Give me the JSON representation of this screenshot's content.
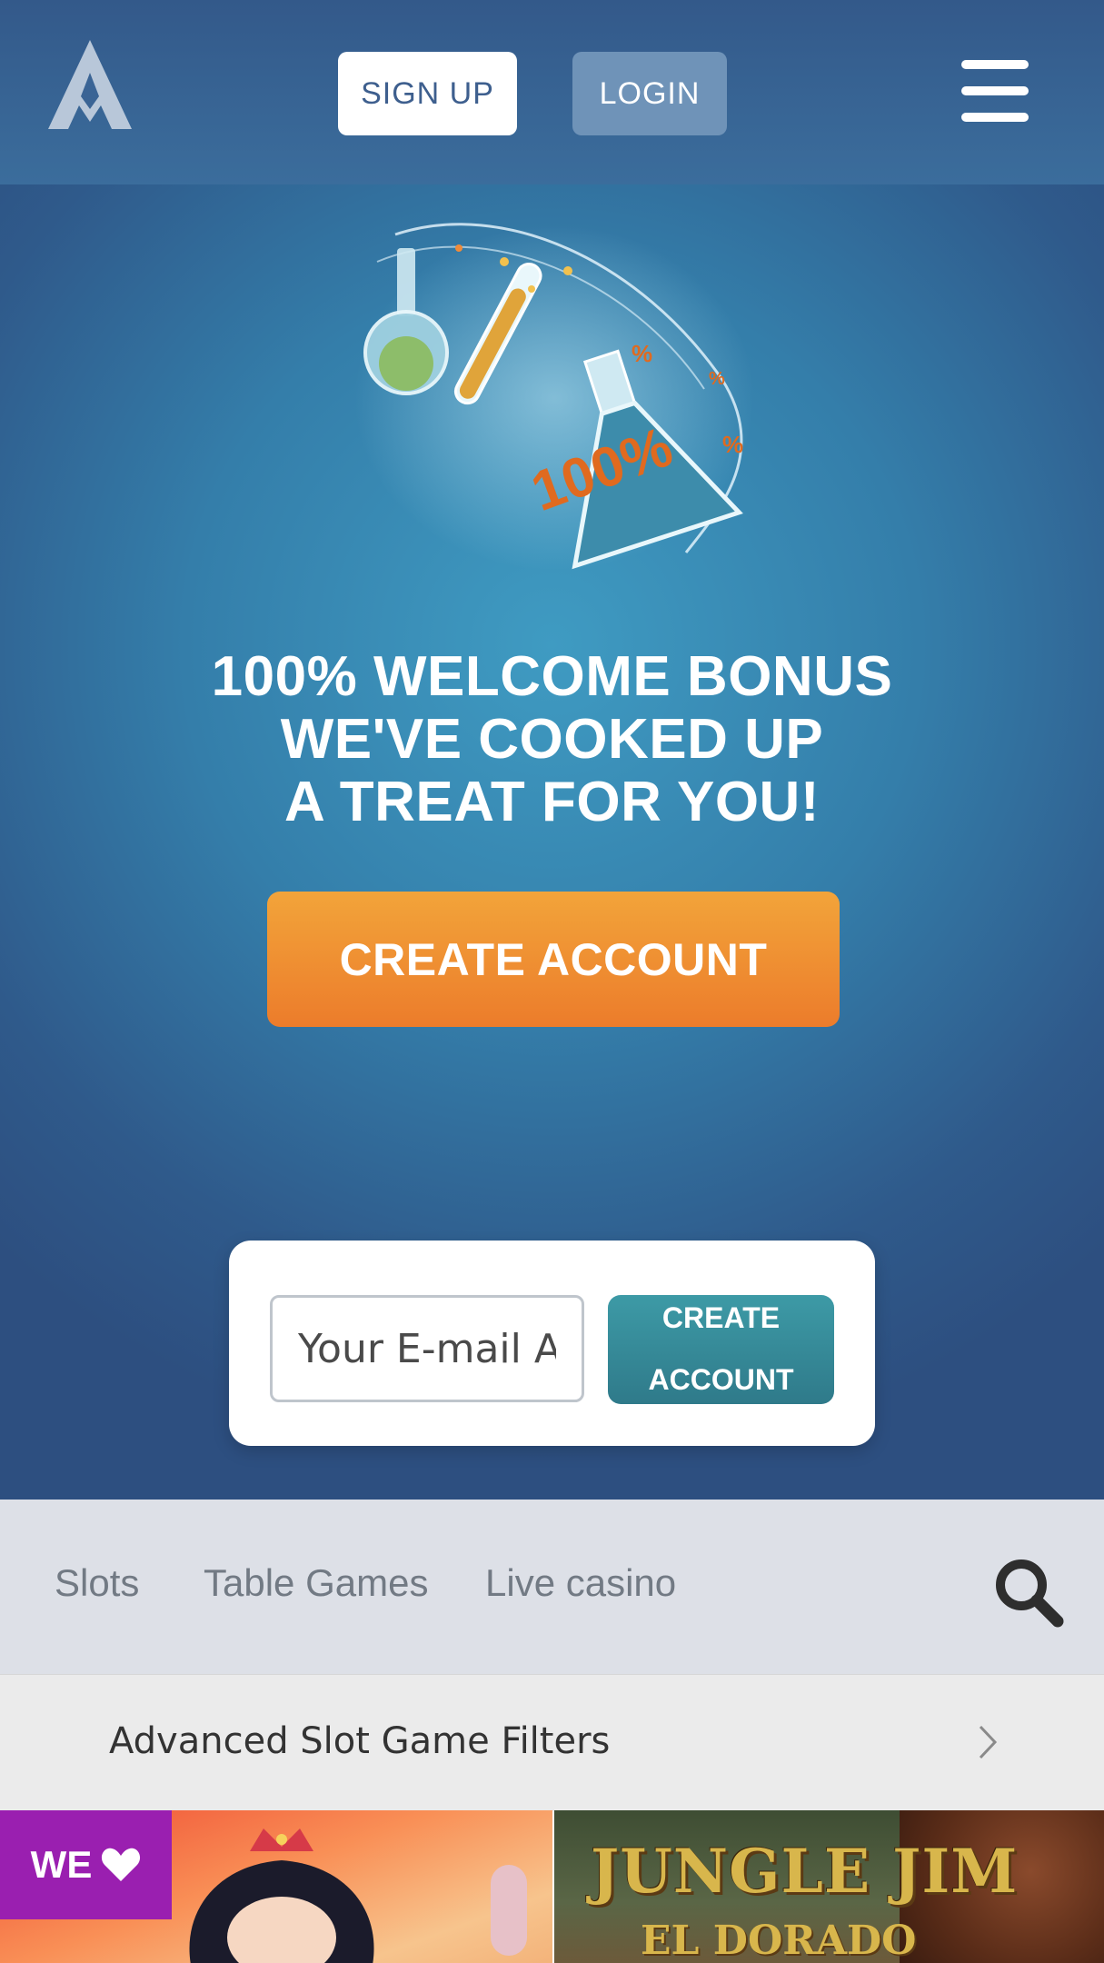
{
  "header": {
    "logo_icon": "alpha-a-logo-icon",
    "signup_label": "SIGN UP",
    "login_label": "LOGIN",
    "menu_icon": "hamburger-menu-icon"
  },
  "hero": {
    "art_icon": "potion-flasks-icon",
    "art_text": "100%",
    "headline": [
      "100% WELCOME BONUS",
      "WE'VE COOKED UP",
      "A TREAT FOR YOU!"
    ],
    "cta_label": "CREATE ACCOUNT"
  },
  "signup_card": {
    "email_placeholder": "Your E-mail A",
    "button_line1": "CREATE",
    "button_line2": "ACCOUNT"
  },
  "categories": {
    "items": [
      "Slots",
      "Table Games",
      "Live casino"
    ],
    "search_icon": "search-icon"
  },
  "filters": {
    "label": "Advanced Slot Game Filters",
    "chevron_icon": "chevron-right-icon"
  },
  "games": {
    "badge_label": "WE",
    "badge_icon": "heart-icon",
    "tile2_title": "JUNGLE JIM",
    "tile2_subtitle": "EL DORADO"
  },
  "colors": {
    "header_bg": "#33598a",
    "cta_orange": "#ef8a2f",
    "card_button_teal": "#3a8f9c",
    "badge_purple": "#9a1fb0",
    "nav_bg": "#dde0e7"
  }
}
